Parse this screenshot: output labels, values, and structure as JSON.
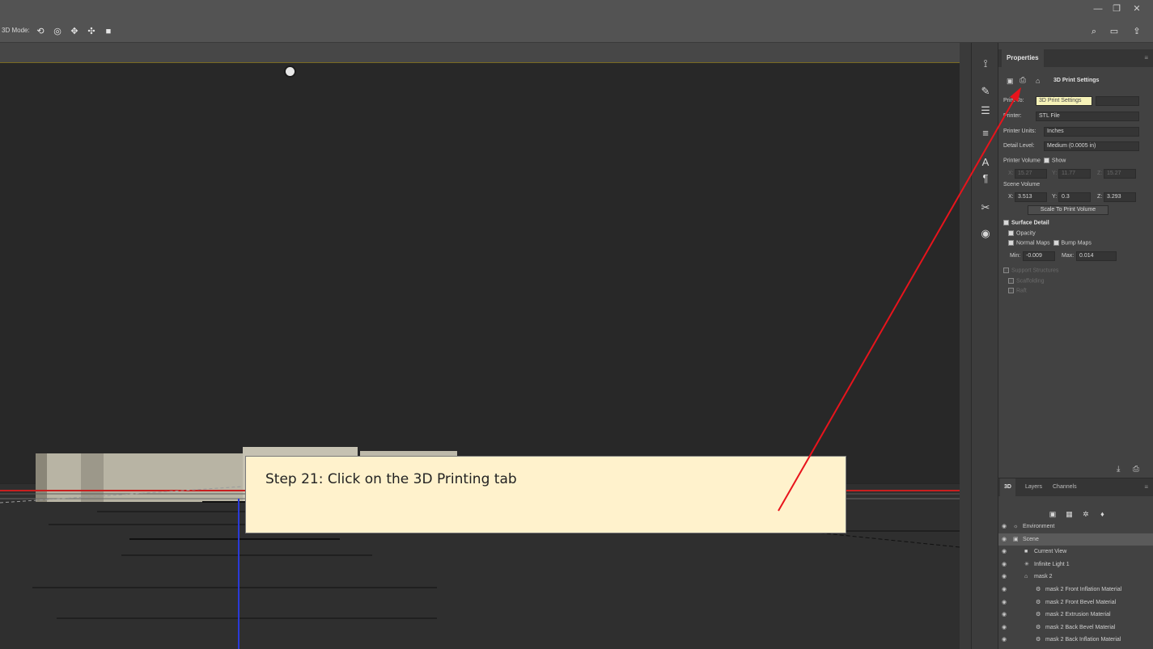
{
  "titlebar": {
    "minimize": "—",
    "restore": "❐",
    "close": "✕"
  },
  "optbar": {
    "mode_label": "3D Mode:",
    "search_icon": "search-icon",
    "workspace_icon": "workspace-icon",
    "share_icon": "share-icon"
  },
  "properties": {
    "tab": "Properties",
    "section_title": "3D Print Settings",
    "print_to_label": "Print To:",
    "print_to_value": "3D Print Settings",
    "printer_label": "Printer:",
    "printer_value": "STL File",
    "units_label": "Printer Units:",
    "units_value": "Inches",
    "detail_label": "Detail Level:",
    "detail_value": "Medium (0.0005 in)",
    "printer_volume_label": "Printer Volume",
    "show_label": "Show",
    "x_label": "X:",
    "y_label": "Y:",
    "z_label": "Z:",
    "pv_x": "15.27",
    "pv_y": "11.77",
    "pv_z": "15.27",
    "scene_volume_label": "Scene Volume",
    "sv_x": "3.513",
    "sv_y": "0.3",
    "sv_z": "3.293",
    "scale_button": "Scale To Print Volume",
    "surface_detail": "Surface Detail",
    "opacity": "Opacity",
    "normal_maps": "Normal Maps",
    "bump_maps": "Bump Maps",
    "min_label": "Min:",
    "min_value": "-0.009",
    "max_label": "Max:",
    "max_value": "0.014",
    "support": "Support Structures",
    "scaffolding": "Scaffolding",
    "raft": "Raft"
  },
  "panel3d": {
    "tabs": [
      "3D",
      "Layers",
      "Channels"
    ],
    "rows": [
      {
        "label": "Environment",
        "indent": 0
      },
      {
        "label": "Scene",
        "indent": 0,
        "selected": true
      },
      {
        "label": "Current View",
        "indent": 1
      },
      {
        "label": "Infinite Light 1",
        "indent": 1
      },
      {
        "label": "mask 2",
        "indent": 1
      },
      {
        "label": "mask 2 Front Inflation Material",
        "indent": 2
      },
      {
        "label": "mask 2 Front Bevel Material",
        "indent": 2
      },
      {
        "label": "mask 2 Extrusion Material",
        "indent": 2
      },
      {
        "label": "mask 2 Back Bevel Material",
        "indent": 2
      },
      {
        "label": "mask 2 Back Inflation Material",
        "indent": 2
      }
    ]
  },
  "callout": {
    "text": "Step 21: Click on the 3D Printing tab"
  },
  "colors": {
    "arrow": "#e8141c",
    "callout_bg": "#fff2cc",
    "highlight": "#f6f2b8"
  }
}
